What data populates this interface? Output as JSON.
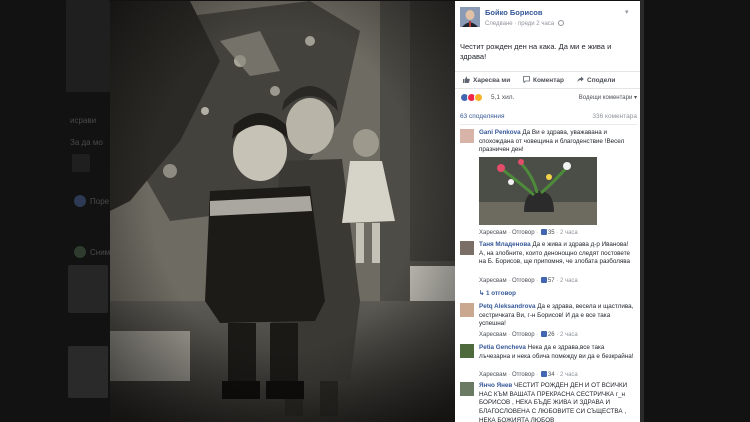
{
  "post": {
    "author": "Бойко Борисов",
    "follow": "Следване",
    "time": "преди 2 часа",
    "text": "Честит рожден ден на кака. Да ми е жива и здрава!"
  },
  "actions": {
    "like": "Харесва ми",
    "comment": "Коментар",
    "share": "Сподели"
  },
  "reactions": {
    "count": "5,1 хил.",
    "order": "Водещи коментари"
  },
  "stats": {
    "shares": "63 споделяния",
    "comments": "336 коментара"
  },
  "comments": [
    {
      "name": "Gani Penkova",
      "text": "Да Ви е здрава, уважавана и спохождана от човещина и благоденствие !Весел празничен ден!",
      "like": "Харесвам",
      "reply": "Отговор",
      "likes": "35",
      "time": "2 часа"
    },
    {
      "name": "Таня Младенова",
      "text": "Да е жива и здрава д-р Иванова! А, на злобните, които денонощно следят постовете на Б. Борисов, ще припомня, че злобата разболява",
      "like": "Харесвам",
      "reply": "Отговор",
      "likes": "57",
      "time": "2 часа",
      "replies": "1 отговор"
    },
    {
      "name": "Petq Aleksandrova",
      "text": "Да е здрава, весела и щастлива, сестричката Ви, г-н Борисов! И да е все така успешна!",
      "like": "Харесвам",
      "reply": "Отговор",
      "likes": "26",
      "time": "2 часа"
    },
    {
      "name": "Petia Gencheva",
      "text": "Нека да е здрава,все така лъчезарна и нека обича помежду ви да е безкрайна!",
      "like": "Харесвам",
      "reply": "Отговор",
      "likes": "34",
      "time": "2 часа"
    },
    {
      "name": "Янчо Янев",
      "text": "ЧЕСТИТ РОЖДЕН ДЕН И ОТ ВСИЧКИ НАС КЪМ ВАШАТА ПРЕКРАСНА СЕСТРИЧКА г_н БОРИСОВ , НЕКА БЪДЕ ЖИВА И ЗДРАВА И БЛАГОСЛОВЕНА С ЛЮБОВИТЕ СИ СЪЩЕСТВА , НЕКА БОЖИЯТА ЛЮБОВ"
    }
  ],
  "background": {
    "snippet1": "исрави ",
    "snippet2": "За да мо",
    "snippet3": "Поре",
    "snippet4": "Снимк"
  },
  "colors": {
    "link": "#365899",
    "like": "#4267b2",
    "love": "#f0284a",
    "haha": "#f7b125"
  }
}
